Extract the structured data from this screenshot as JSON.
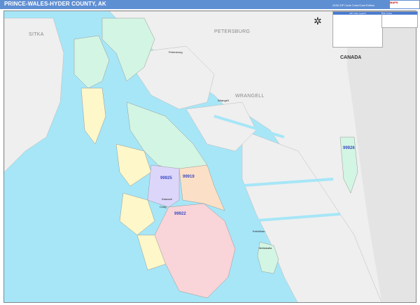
{
  "header": {
    "title": "PRINCE-WALES-HYDER COUNTY, AK",
    "edition": "2026 ZIP Code Color/Cast Edition",
    "logo_text": "MAPS"
  },
  "map": {
    "region_labels": {
      "sitka": "SITKA",
      "petersburg": "PETERSBURG",
      "wrangell": "WRANGELL",
      "canada": "CANADA"
    },
    "towns": {
      "petersburg": "Petersburg",
      "wrangell": "Wrangell",
      "ketchikan": "Ketchikan",
      "metlakatla": "Metlakatla",
      "craig": "Craig",
      "klawock": "Klawock"
    },
    "zip_codes": [
      "99925",
      "99919",
      "99922",
      "99926"
    ],
    "colors": {
      "water": "#a6e6f7",
      "land": "#efefef",
      "z99925": "#ddd6fb",
      "z99919": "#fbe0c7",
      "z99922": "#f9d4d8",
      "z99926": "#d3f5e3",
      "yellow": "#fdf7c9",
      "green": "#d3f5e3"
    }
  },
  "legend": {
    "title": "ZIP Code Legend"
  },
  "ziplist": {
    "title": "ZIP Codes"
  }
}
